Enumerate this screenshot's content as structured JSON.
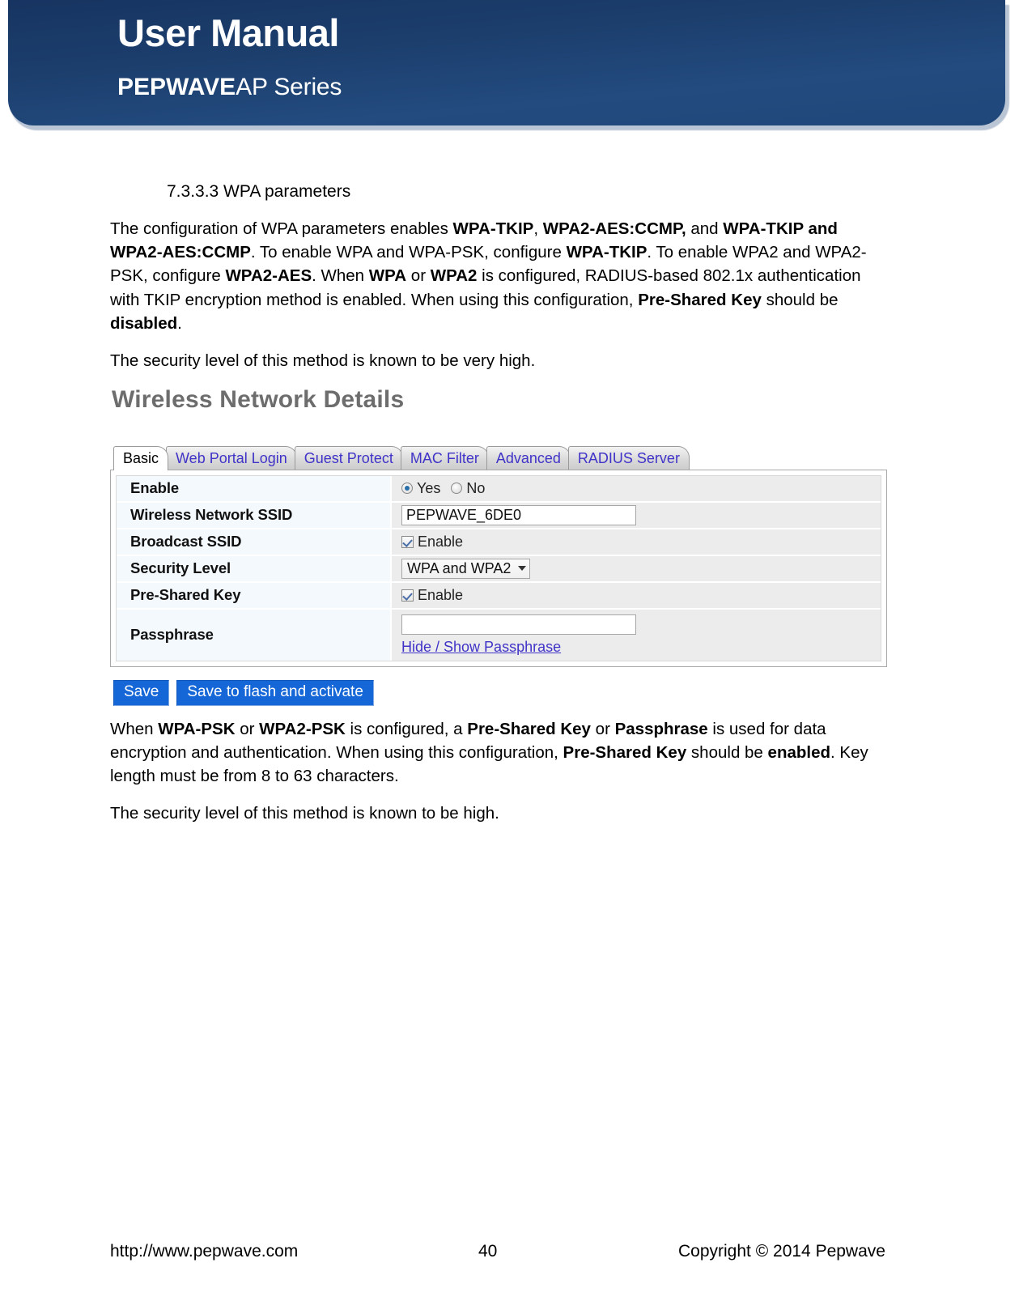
{
  "banner": {
    "title": "User Manual",
    "brand": "PEPWAVE",
    "series": "AP Series"
  },
  "document": {
    "section_heading": "7.3.3.3 WPA parameters",
    "paragraph1_parts": [
      {
        "t": "The configuration of WPA parameters enables ",
        "b": false
      },
      {
        "t": "WPA-TKIP",
        "b": true
      },
      {
        "t": ", ",
        "b": false
      },
      {
        "t": "WPA2-AES:CCMP,",
        "b": true
      },
      {
        "t": " and ",
        "b": false
      },
      {
        "t": "WPA-TKIP and WPA2-AES:CCMP",
        "b": true
      },
      {
        "t": ". To enable WPA and WPA-PSK, configure ",
        "b": false
      },
      {
        "t": "WPA-TKIP",
        "b": true
      },
      {
        "t": ". To enable WPA2 and WPA2-PSK, configure ",
        "b": false
      },
      {
        "t": "WPA2-AES",
        "b": true
      },
      {
        "t": ". When ",
        "b": false
      },
      {
        "t": "WPA",
        "b": true
      },
      {
        "t": " or ",
        "b": false
      },
      {
        "t": "WPA2",
        "b": true
      },
      {
        "t": " is configured, RADIUS-based 802.1x authentication with TKIP encryption method is enabled. When using this configuration, ",
        "b": false
      },
      {
        "t": "Pre-Shared Key",
        "b": true
      },
      {
        "t": " should be ",
        "b": false
      },
      {
        "t": "disabled",
        "b": true
      },
      {
        "t": ".",
        "b": false
      }
    ],
    "paragraph2": "The security level of this method is known to be very high.",
    "paragraph3_parts": [
      {
        "t": "When ",
        "b": false
      },
      {
        "t": "WPA-PSK",
        "b": true
      },
      {
        "t": " or ",
        "b": false
      },
      {
        "t": "WPA2-PSK",
        "b": true
      },
      {
        "t": " is configured, a ",
        "b": false
      },
      {
        "t": "Pre-Shared Key",
        "b": true
      },
      {
        "t": " or ",
        "b": false
      },
      {
        "t": "Passphrase",
        "b": true
      },
      {
        "t": " is used for data encryption and authentication. When using this configuration, ",
        "b": false
      },
      {
        "t": "Pre-Shared Key",
        "b": true
      },
      {
        "t": " should be ",
        "b": false
      },
      {
        "t": "enabled",
        "b": true
      },
      {
        "t": ". Key length must be from 8 to 63 characters.",
        "b": false
      }
    ],
    "paragraph4": "The security level of this method is known to be high."
  },
  "screenshot": {
    "title": "Wireless Network Details",
    "tabs": [
      {
        "label": "Basic",
        "active": true
      },
      {
        "label": "Web Portal Login",
        "active": false
      },
      {
        "label": "Guest Protect",
        "active": false
      },
      {
        "label": "MAC Filter",
        "active": false
      },
      {
        "label": "Advanced",
        "active": false
      },
      {
        "label": "RADIUS Server",
        "active": false
      }
    ],
    "form": {
      "enable": {
        "label": "Enable",
        "yes_label": "Yes",
        "no_label": "No",
        "selected": "Yes"
      },
      "ssid": {
        "label": "Wireless Network SSID",
        "value": "PEPWAVE_6DE0"
      },
      "broadcast_ssid": {
        "label": "Broadcast SSID",
        "checkbox_label": "Enable",
        "checked": true
      },
      "security_level": {
        "label": "Security Level",
        "value": "WPA and WPA2"
      },
      "pre_shared_key": {
        "label": "Pre-Shared Key",
        "checkbox_label": "Enable",
        "checked": true
      },
      "passphrase": {
        "label": "Passphrase",
        "value": "",
        "toggle_link": "Hide / Show Passphrase"
      }
    },
    "buttons": {
      "save": "Save",
      "save_flash": "Save to flash and activate"
    },
    "colors": {
      "tab_link": "#4033c8",
      "button_blue": "#1566d6",
      "title_gray": "#6d6d6d"
    }
  },
  "footer": {
    "url": "http://www.pepwave.com",
    "page_number": "40",
    "copyright": "Copyright ©  2014  Pepwave"
  }
}
